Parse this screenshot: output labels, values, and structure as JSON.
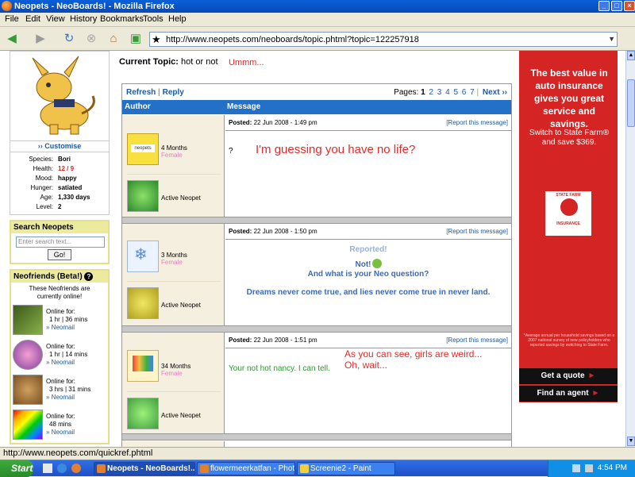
{
  "window": {
    "title": "Neopets - NeoBoards! - Mozilla Firefox"
  },
  "menu": [
    "File",
    "Edit",
    "View",
    "History",
    "Bookmarks",
    "Tools",
    "Help"
  ],
  "address": {
    "url": "http://www.neopets.com/neoboards/topic.phtml?topic=122257918"
  },
  "sidebar": {
    "customise": "›› Customise",
    "stats": [
      {
        "k": "Species:",
        "v": "Bori"
      },
      {
        "k": "Health:",
        "v": "12 / 9"
      },
      {
        "k": "Mood:",
        "v": "happy"
      },
      {
        "k": "Hunger:",
        "v": "satiated"
      },
      {
        "k": "Age:",
        "v": "1,330 days"
      },
      {
        "k": "Level:",
        "v": "2"
      }
    ],
    "search": {
      "title": "Search Neopets",
      "placeholder": "Enter search text...",
      "go": "Go!"
    },
    "friends": {
      "title": "Neofriends (Beta!)",
      "help": "?",
      "intro": "These Neofriends are currently online!",
      "list": [
        {
          "online": "Online for:",
          "time": "1 hr | 36 mins",
          "mail": "» Neomail"
        },
        {
          "online": "Online for:",
          "time": "1 hr | 14 mins",
          "mail": "» Neomail"
        },
        {
          "online": "Online for:",
          "time": "3 hrs | 31 mins",
          "mail": "» Neomail"
        },
        {
          "online": "Online for:",
          "time": "48 mins",
          "mail": "» Neomail"
        }
      ]
    }
  },
  "topic": {
    "label": "Current Topic:",
    "title": "hot or not",
    "note": "Ummm..."
  },
  "forum": {
    "refresh": "Refresh",
    "reply": "Reply",
    "pages_label": "Pages:",
    "pages": [
      "1",
      "2",
      "3",
      "4",
      "5",
      "6",
      "7"
    ],
    "next": "Next ››",
    "col_author": "Author",
    "col_message": "Message",
    "report": "[Report this message]",
    "posts": [
      {
        "posted": "Posted:",
        "date": "22 Jun 2008 - 1:49 pm",
        "age": "4 Months",
        "gender": "Female",
        "status": "Active Neopet",
        "body": "?",
        "annotation": "I'm guessing you have no life?"
      },
      {
        "posted": "Posted:",
        "date": "22 Jun 2008 - 1:50 pm",
        "age": "3 Months",
        "gender": "Female",
        "status": "Active Neopet",
        "reported": "Reported!",
        "line1": "Not!",
        "line2": "And what is your Neo question?",
        "line3": "Dreams never come true, and lies never come true in never land."
      },
      {
        "posted": "Posted:",
        "date": "22 Jun 2008 - 1:51 pm",
        "age": "34 Months",
        "gender": "Female",
        "status": "Active Neopet",
        "body": "Your not hot nancy. I can tell.",
        "annotation1": "As you can see, girls are weird...",
        "annotation2": "Oh, wait..."
      }
    ]
  },
  "ad": {
    "headline": "The best value in auto insurance gives you great service and savings.",
    "offer": "Switch to State Farm® and save $369.",
    "logo_top": "STATE FARM",
    "logo_bottom": "INSURANCE",
    "fine": "*Average annual per household savings based on a 2007 national survey of new policyholders who reported savings by switching to State Farm.",
    "cta1": "Get a quote",
    "cta2": "Find an agent",
    "colors": {
      "bg": "#d42424"
    }
  },
  "status": {
    "text": "http://www.neopets.com/quickref.phtml"
  },
  "taskbar": {
    "start": "Start",
    "tasks": [
      "Neopets - NeoBoards!...",
      "flowermeerkatfan - Photob...",
      "Screenie2 - Paint"
    ],
    "clock": "4:54 PM"
  }
}
